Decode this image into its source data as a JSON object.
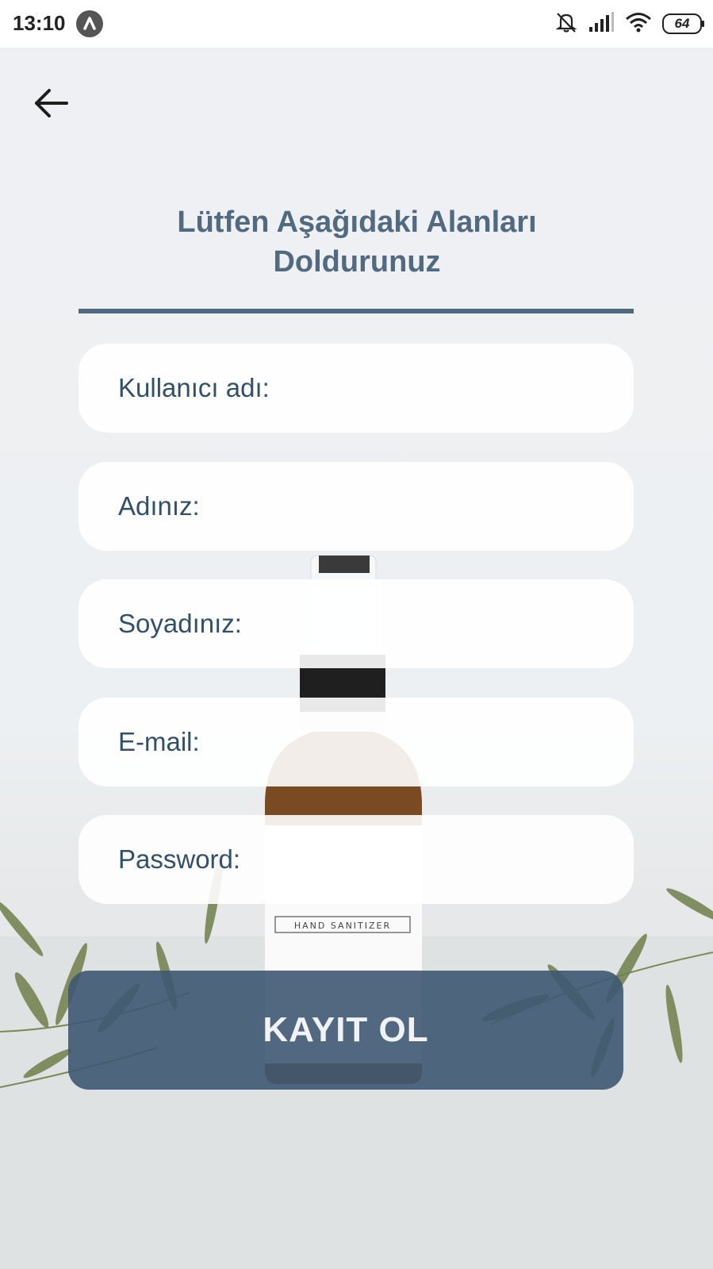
{
  "status_bar": {
    "time": "13:10",
    "battery": "64"
  },
  "header": {
    "back_icon": "arrow-left-icon"
  },
  "form": {
    "title": "Lütfen Aşağıdaki Alanları Doldurunuz",
    "fields": [
      {
        "label": "Kullanıcı adı:"
      },
      {
        "label": "Adınız:"
      },
      {
        "label": "Soyadınız:"
      },
      {
        "label": "E-mail:"
      },
      {
        "label": "Password:"
      }
    ],
    "submit_label": "KAYIT OL"
  },
  "background": {
    "product_label": "HAND SANITIZER"
  },
  "colors": {
    "accent": "#4f6a80",
    "button": "#3e5872",
    "field_text": "#32506a"
  }
}
